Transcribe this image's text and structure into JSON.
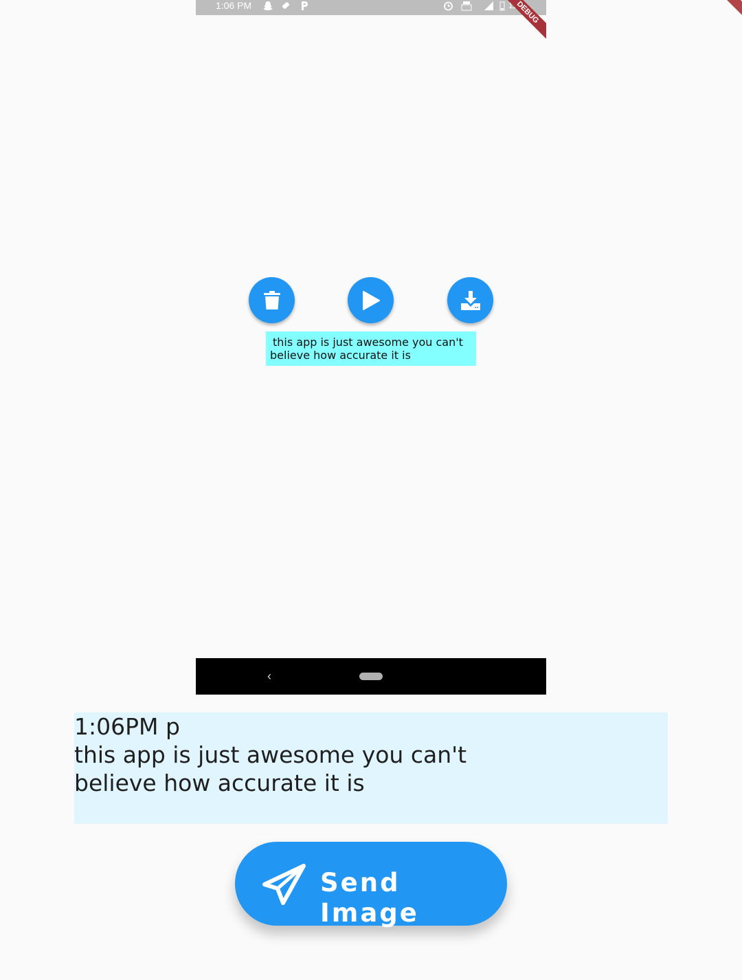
{
  "status_bar": {
    "time": "1:06 PM",
    "battery": "11%",
    "debug_label": "DEBUG",
    "icons": [
      "snapchat-icon",
      "tag-icon",
      "parking-icon",
      "alarm-icon",
      "volte-icon",
      "signal-icon",
      "battery-icon"
    ]
  },
  "actions": {
    "delete_icon": "trash-icon",
    "play_icon": "play-icon",
    "download_icon": "download-icon",
    "accent_color": "#2196f3"
  },
  "preview_caption": {
    "line1": "this app is just awesome you can't",
    "line2": "believe how accurate it is",
    "background": "#84ffff"
  },
  "navigation": {
    "back_glyph": "‹"
  },
  "message": {
    "header": "1:06PM p",
    "line1": "this app is just awesome you can't",
    "line2": "believe how accurate it is",
    "background": "#e1f5fe"
  },
  "send_button": {
    "label": "Send Image",
    "icon": "paper-plane-icon",
    "color": "#2196f3"
  }
}
